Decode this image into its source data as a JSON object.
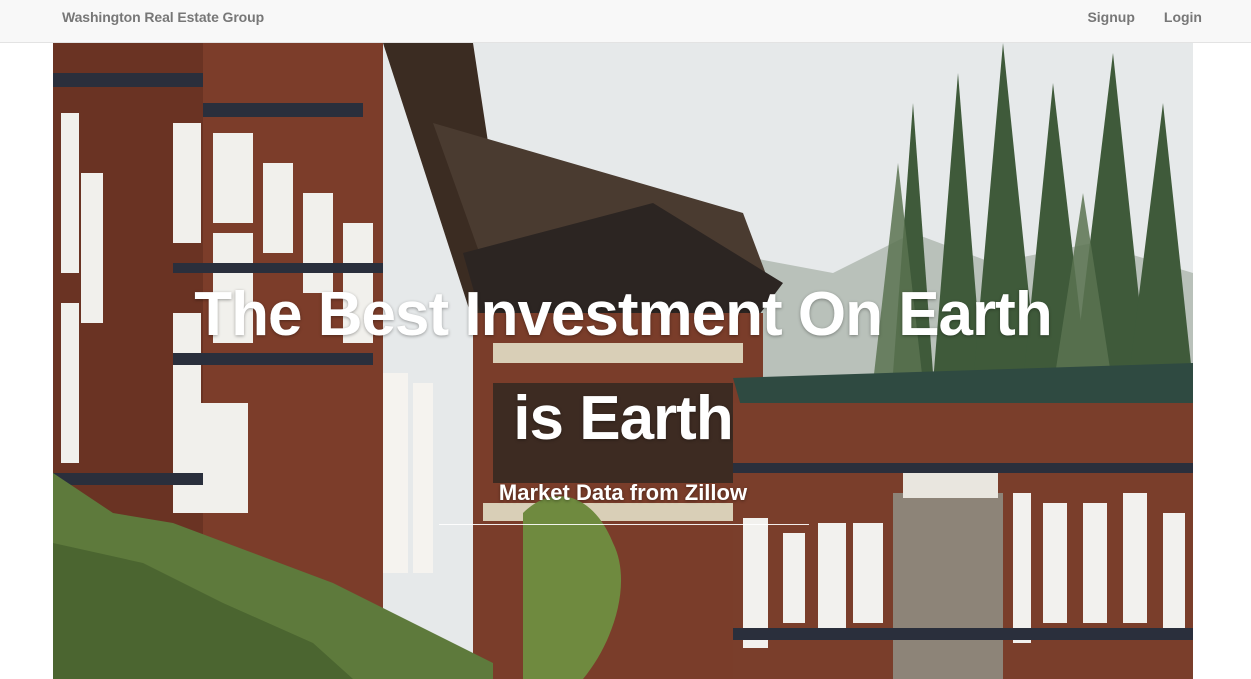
{
  "navbar": {
    "brand": "Washington Real Estate Group",
    "links": [
      {
        "label": "Signup"
      },
      {
        "label": "Login"
      }
    ]
  },
  "hero": {
    "headline_line1": "The Best Investment On Earth",
    "headline_line2": "is Earth",
    "subheading": "Market Data from Zillow"
  },
  "colors": {
    "navbar_bg": "#f8f8f8",
    "nav_text": "#777777",
    "hero_text": "#ffffff"
  }
}
